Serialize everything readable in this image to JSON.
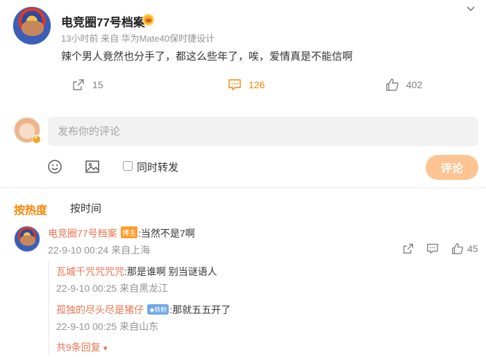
{
  "post": {
    "author": "电竞圈77号档案",
    "meta": "13小时前 来自 华为Mate40保时捷设计",
    "text": "辣个男人竟然也分手了，都这么些年了，唉，爱情真是不能信啊",
    "repost_count": "15",
    "comment_count": "126",
    "like_count": "402"
  },
  "composer": {
    "placeholder": "发布你的评论",
    "repost_label": "同时转发",
    "submit_label": "评论"
  },
  "sort": {
    "hot": "按热度",
    "time": "按时间"
  },
  "comments": [
    {
      "author": "电竞圈77号档案",
      "badge": "博主",
      "text": ":当然不是7啊",
      "meta": "22-9-10 00:24 来自上海",
      "like_count": "45",
      "replies": [
        {
          "author": "瓦城千咒咒咒咒",
          "text": ":那是谁啊 别当谜语人",
          "meta": "22-9-10 00:25 来自黑龙江"
        },
        {
          "author": "孤独的尽头尽是猪仔",
          "badge": "铁粉",
          "text": ":那就五五开了",
          "meta": "22-9-10 00:25 来自山东"
        }
      ],
      "expand_label": "共9条回复"
    }
  ],
  "colors": {
    "accent": "#ff8200",
    "name": "#eb7350",
    "muted": "#939393",
    "button": "#ffc492"
  }
}
